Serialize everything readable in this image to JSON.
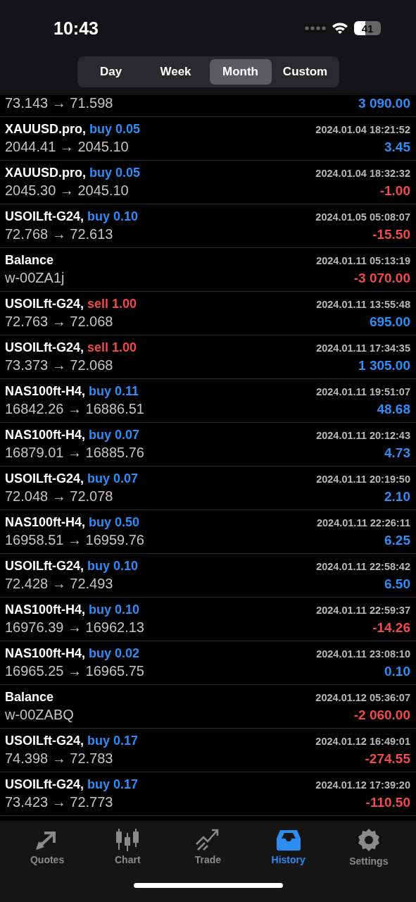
{
  "status_bar": {
    "time": "10:43",
    "battery": "41"
  },
  "period_tabs": [
    {
      "label": "Day",
      "selected": false
    },
    {
      "label": "Week",
      "selected": false
    },
    {
      "label": "Month",
      "selected": true
    },
    {
      "label": "Custom",
      "selected": false
    }
  ],
  "deals": [
    {
      "kind": "tail",
      "prices": "73.143 → 71.598",
      "profit": "3 090.00",
      "loss": false
    },
    {
      "kind": "trade",
      "symbol": "XAUUSD.pro,",
      "sell": false,
      "volume": "buy 0.05",
      "time": "2024.01.04 18:21:52",
      "prices": "2044.41 → 2045.10",
      "profit": "3.45",
      "loss": false
    },
    {
      "kind": "trade",
      "symbol": "XAUUSD.pro,",
      "sell": false,
      "volume": "buy 0.05",
      "time": "2024.01.04 18:32:32",
      "prices": "2045.30 → 2045.10",
      "profit": "-1.00",
      "loss": true
    },
    {
      "kind": "trade",
      "symbol": "USOILft-G24,",
      "sell": false,
      "volume": "buy 0.10",
      "time": "2024.01.05 05:08:07",
      "prices": "72.768 → 72.613",
      "profit": "-15.50",
      "loss": true
    },
    {
      "kind": "balance",
      "symbol": "Balance",
      "time": "2024.01.11 05:13:19",
      "prices": "w-00ZA1j",
      "profit": "-3 070.00",
      "loss": true
    },
    {
      "kind": "trade",
      "symbol": "USOILft-G24,",
      "sell": true,
      "volume": "sell 1.00",
      "time": "2024.01.11 13:55:48",
      "prices": "72.763 → 72.068",
      "profit": "695.00",
      "loss": false
    },
    {
      "kind": "trade",
      "symbol": "USOILft-G24,",
      "sell": true,
      "volume": "sell 1.00",
      "time": "2024.01.11 17:34:35",
      "prices": "73.373 → 72.068",
      "profit": "1 305.00",
      "loss": false
    },
    {
      "kind": "trade",
      "symbol": "NAS100ft-H4,",
      "sell": false,
      "volume": "buy 0.11",
      "time": "2024.01.11 19:51:07",
      "prices": "16842.26 → 16886.51",
      "profit": "48.68",
      "loss": false
    },
    {
      "kind": "trade",
      "symbol": "NAS100ft-H4,",
      "sell": false,
      "volume": "buy 0.07",
      "time": "2024.01.11 20:12:43",
      "prices": "16879.01 → 16885.76",
      "profit": "4.73",
      "loss": false
    },
    {
      "kind": "trade",
      "symbol": "USOILft-G24,",
      "sell": false,
      "volume": "buy 0.07",
      "time": "2024.01.11 20:19:50",
      "prices": "72.048 → 72.078",
      "profit": "2.10",
      "loss": false
    },
    {
      "kind": "trade",
      "symbol": "NAS100ft-H4,",
      "sell": false,
      "volume": "buy 0.50",
      "time": "2024.01.11 22:26:11",
      "prices": "16958.51 → 16959.76",
      "profit": "6.25",
      "loss": false
    },
    {
      "kind": "trade",
      "symbol": "USOILft-G24,",
      "sell": false,
      "volume": "buy 0.10",
      "time": "2024.01.11 22:58:42",
      "prices": "72.428 → 72.493",
      "profit": "6.50",
      "loss": false
    },
    {
      "kind": "trade",
      "symbol": "NAS100ft-H4,",
      "sell": false,
      "volume": "buy 0.10",
      "time": "2024.01.11 22:59:37",
      "prices": "16976.39 → 16962.13",
      "profit": "-14.26",
      "loss": true
    },
    {
      "kind": "trade",
      "symbol": "NAS100ft-H4,",
      "sell": false,
      "volume": "buy 0.02",
      "time": "2024.01.11 23:08:10",
      "prices": "16965.25 → 16965.75",
      "profit": "0.10",
      "loss": false
    },
    {
      "kind": "balance",
      "symbol": "Balance",
      "time": "2024.01.12 05:36:07",
      "prices": "w-00ZABQ",
      "profit": "-2 060.00",
      "loss": true
    },
    {
      "kind": "trade",
      "symbol": "USOILft-G24,",
      "sell": false,
      "volume": "buy 0.17",
      "time": "2024.01.12 16:49:01",
      "prices": "74.398 → 72.783",
      "profit": "-274.55",
      "loss": true
    },
    {
      "kind": "trade",
      "symbol": "USOILft-G24,",
      "sell": false,
      "volume": "buy 0.17",
      "time": "2024.01.12 17:39:20",
      "prices": "73.423 → 72.773",
      "profit": "-110.50",
      "loss": true
    }
  ],
  "tab_bar": [
    {
      "kind": "quotes",
      "label": "Quotes",
      "selected": false
    },
    {
      "kind": "chart",
      "label": "Chart",
      "selected": false
    },
    {
      "kind": "trade",
      "label": "Trade",
      "selected": false
    },
    {
      "kind": "history",
      "label": "History",
      "selected": true
    },
    {
      "kind": "settings",
      "label": "Settings",
      "selected": false
    }
  ]
}
